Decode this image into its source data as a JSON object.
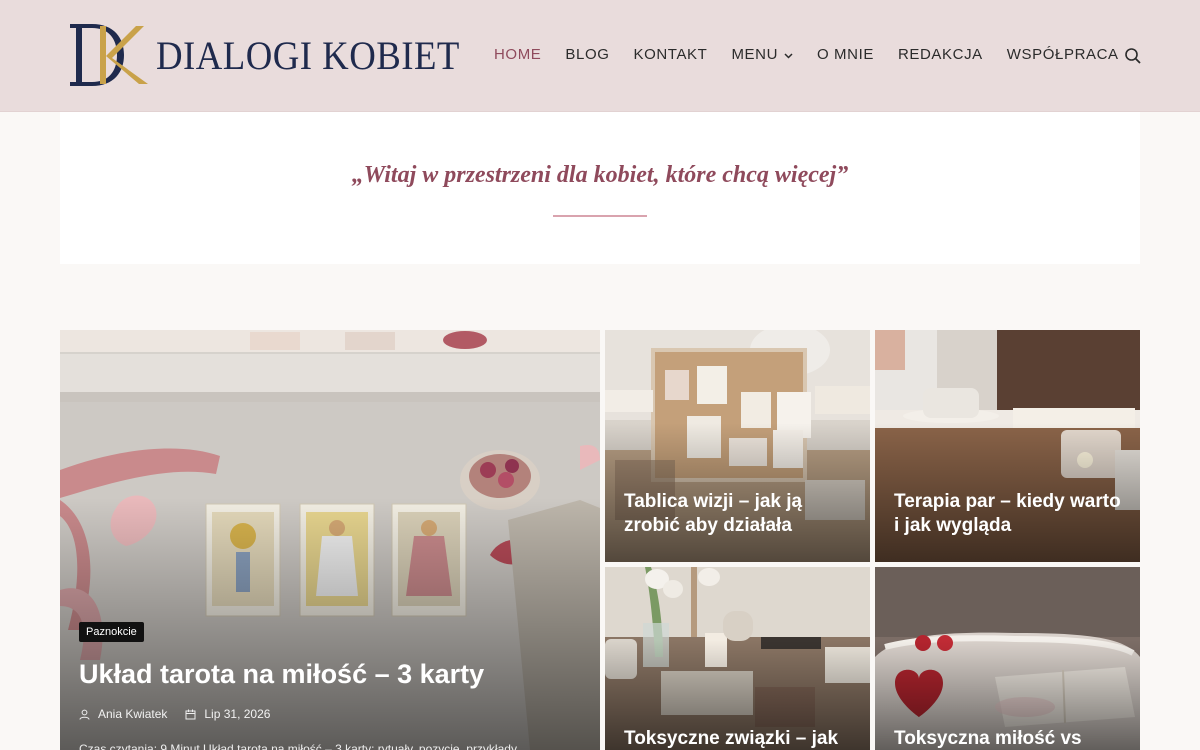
{
  "brand": {
    "monogram": "DK",
    "name": "DIALOGI KOBIET"
  },
  "nav": {
    "items": [
      "HOME",
      "BLOG",
      "KONTAKT",
      "MENU",
      "O MNIE",
      "REDAKCJA",
      "WSPÓŁPRACA"
    ],
    "active": "HOME"
  },
  "welcome": {
    "text": "„Witaj w przestrzeni dla kobiet, które chcą więcej”"
  },
  "featured": {
    "category": "Paznokcie",
    "title": "Układ tarota na miłość – 3 karty",
    "author": "Ania Kwiatek",
    "date": "Lip 31, 2026",
    "excerpt": "Czas czytania: 9 Minut Układ tarota na miłość – 3 karty: rytuały, pozycje, przykłady"
  },
  "posts": [
    {
      "title_line1": "Tablica wizji – jak ją",
      "title_line2": "zrobić aby działała"
    },
    {
      "title_line1": "Terapia par – kiedy warto",
      "title_line2": "i jak wygląda"
    },
    {
      "title_line1": "Toksyczne związki – jak",
      "title_line2": ""
    },
    {
      "title_line1": "Toksyczna miłość vs",
      "title_line2": ""
    }
  ],
  "colors": {
    "header_bg": "#e9dcdc",
    "accent": "#8f4a5c",
    "brand_navy": "#1f2a4d",
    "brand_gold": "#c9a24a"
  },
  "icons": {
    "search": "search-icon",
    "menu_dropdown": "chevron-down-icon",
    "author": "user-icon",
    "date": "calendar-icon"
  }
}
